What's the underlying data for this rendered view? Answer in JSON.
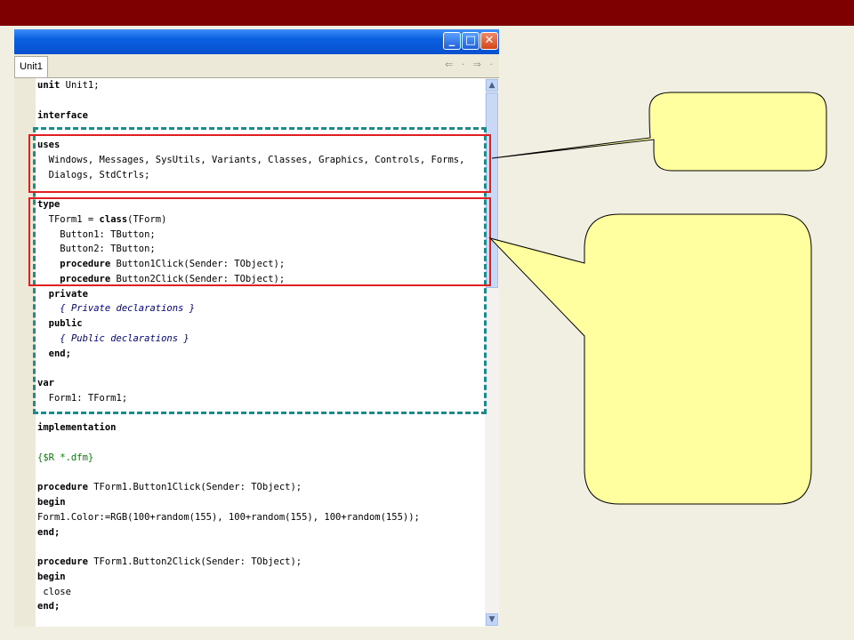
{
  "window": {
    "title_buttons": {
      "minimize": "_",
      "maximize": "□",
      "close": "✕"
    },
    "tab_label": "Unit1",
    "nav_arrows": "⇐ · ⇒ ·"
  },
  "code_lines": [
    [
      {
        "t": "unit",
        "k": "kw"
      },
      {
        "t": " Unit1;"
      }
    ],
    [],
    [
      {
        "t": "interface",
        "k": "kw"
      }
    ],
    [],
    [
      {
        "t": "uses",
        "k": "kw"
      }
    ],
    [
      {
        "t": "  Windows, Messages, SysUtils, Variants, Classes, Graphics, Controls, Forms,"
      }
    ],
    [
      {
        "t": "  Dialogs, StdCtrls;"
      }
    ],
    [],
    [
      {
        "t": "type",
        "k": "kw"
      }
    ],
    [
      {
        "t": "  TForm1 = "
      },
      {
        "t": "class",
        "k": "kw"
      },
      {
        "t": "(TForm)"
      }
    ],
    [
      {
        "t": "    Button1: TButton;"
      }
    ],
    [
      {
        "t": "    Button2: TButton;"
      }
    ],
    [
      {
        "t": "    "
      },
      {
        "t": "procedure",
        "k": "kw"
      },
      {
        "t": " Button1Click(Sender: TObject);"
      }
    ],
    [
      {
        "t": "    "
      },
      {
        "t": "procedure",
        "k": "kw"
      },
      {
        "t": " Button2Click(Sender: TObject);"
      }
    ],
    [
      {
        "t": "  "
      },
      {
        "t": "private",
        "k": "kw"
      }
    ],
    [
      {
        "t": "    "
      },
      {
        "t": "{ Private declarations }",
        "k": "cm"
      }
    ],
    [
      {
        "t": "  "
      },
      {
        "t": "public",
        "k": "kw"
      }
    ],
    [
      {
        "t": "    "
      },
      {
        "t": "{ Public declarations }",
        "k": "cm"
      }
    ],
    [
      {
        "t": "  "
      },
      {
        "t": "end;",
        "k": "kw"
      }
    ],
    [],
    [
      {
        "t": "var",
        "k": "kw"
      }
    ],
    [
      {
        "t": "  Form1: TForm1;"
      }
    ],
    [],
    [
      {
        "t": "implementation",
        "k": "kw"
      }
    ],
    [],
    [
      {
        "t": "{$R *.dfm}",
        "k": "dir"
      }
    ],
    [],
    [
      {
        "t": "procedure",
        "k": "kw"
      },
      {
        "t": " TForm1.Button1Click(Sender: TObject);"
      }
    ],
    [
      {
        "t": "begin",
        "k": "kw"
      }
    ],
    [
      {
        "t": "Form1.Color:=RGB(100+random(155), 100+random(155), 100+random(155));"
      }
    ],
    [
      {
        "t": "end;",
        "k": "kw"
      }
    ],
    [],
    [
      {
        "t": "procedure",
        "k": "kw"
      },
      {
        "t": " TForm1.Button2Click(Sender: TObject);"
      }
    ],
    [
      {
        "t": "begin",
        "k": "kw"
      }
    ],
    [
      {
        "t": " close"
      }
    ],
    [
      {
        "t": "end;",
        "k": "kw"
      }
    ]
  ],
  "colors": {
    "header_bar": "#7e0000",
    "background": "#f1efe2",
    "highlight_red": "#e02020",
    "highlight_teal": "#1e8a8a",
    "callout_fill": "#ffffa0"
  }
}
